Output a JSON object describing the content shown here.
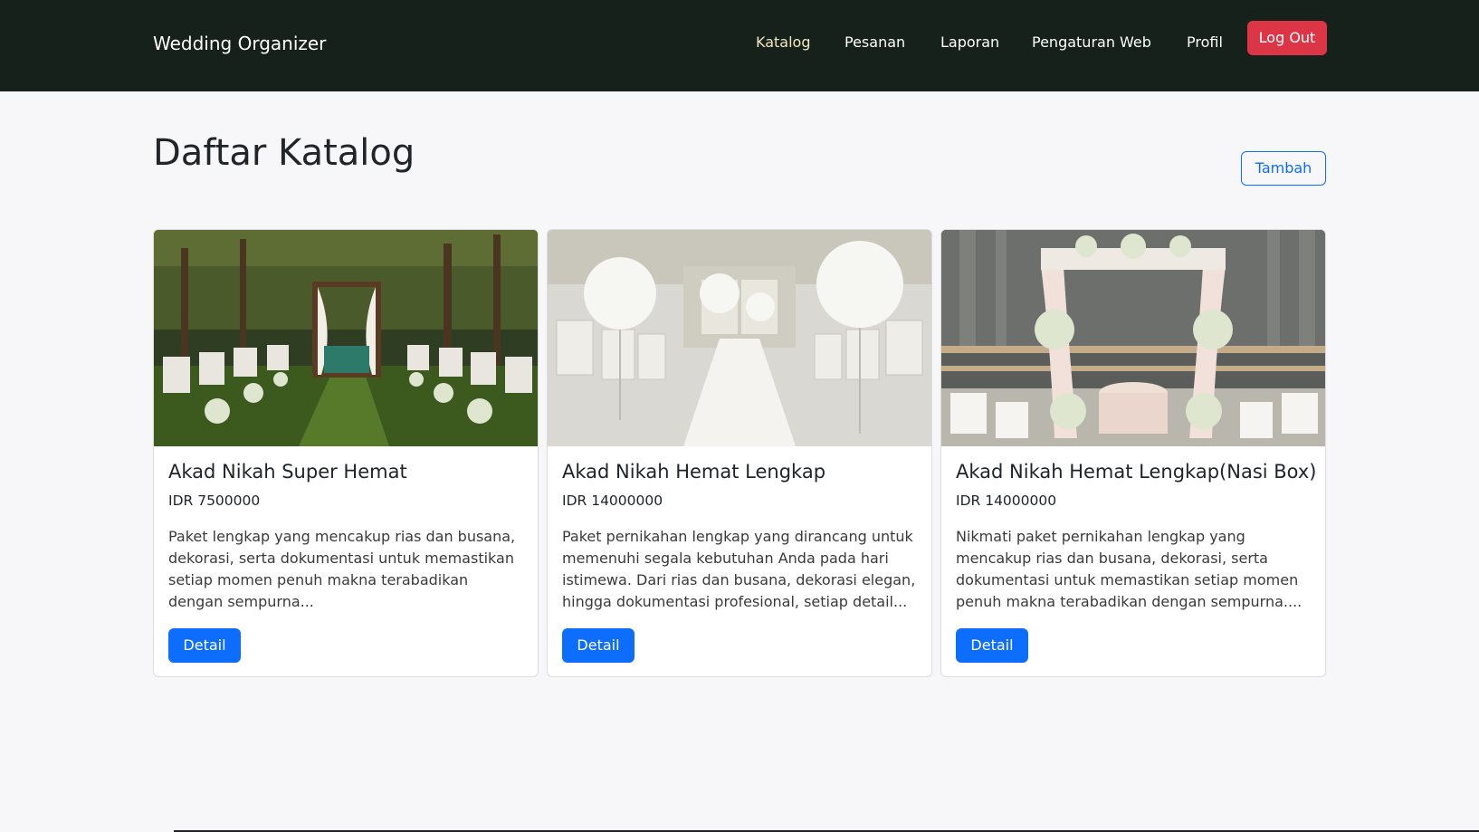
{
  "navbar": {
    "brand": "Wedding Organizer",
    "links": [
      {
        "label": "Katalog",
        "active": true
      },
      {
        "label": "Pesanan",
        "active": false
      },
      {
        "label": "Laporan",
        "active": false
      },
      {
        "label": "Pengaturan Web",
        "active": false
      },
      {
        "label": "Profil",
        "active": false
      }
    ],
    "logout_label": "Log Out"
  },
  "page": {
    "title": "Daftar Katalog",
    "add_label": "Tambah"
  },
  "cards": [
    {
      "title": "Akad Nikah Super Hemat",
      "price": "IDR 7500000",
      "description": "Paket lengkap yang mencakup rias dan busana, dekorasi, serta dokumentasi untuk memastikan setiap momen penuh makna terabadikan dengan sempurna...",
      "button_label": "Detail"
    },
    {
      "title": "Akad Nikah Hemat Lengkap",
      "price": "IDR 14000000",
      "description": "Paket pernikahan lengkap yang dirancang untuk memenuhi segala kebutuhan Anda pada hari istimewa. Dari rias dan busana, dekorasi elegan, hingga dokumentasi profesional, setiap detail...",
      "button_label": "Detail"
    },
    {
      "title": "Akad Nikah Hemat Lengkap(Nasi Box)",
      "price": "IDR 14000000",
      "description": "Nikmati paket pernikahan lengkap yang mencakup rias dan busana, dekorasi, serta dokumentasi untuk memastikan setiap momen penuh makna terabadikan dengan sempurna....",
      "button_label": "Detail"
    }
  ],
  "colors": {
    "navbar_bg": "#15211a",
    "logout": "#dc3545",
    "primary": "#0d6efd",
    "page_bg": "#f7f7f9"
  }
}
